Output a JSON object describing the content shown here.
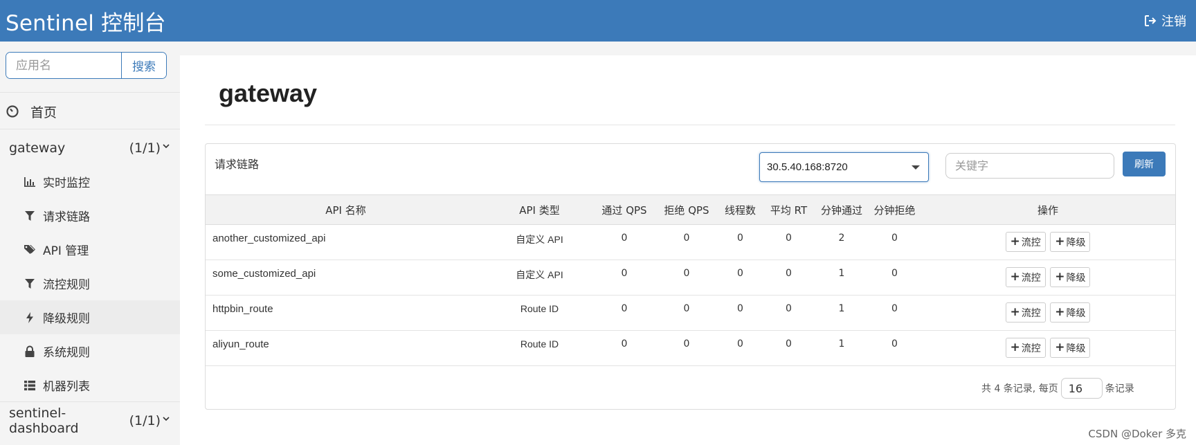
{
  "header": {
    "brand": "Sentinel 控制台",
    "logout_label": "注销"
  },
  "sidebar": {
    "search_placeholder": "应用名",
    "search_button": "搜索",
    "home_label": "首页",
    "apps": [
      {
        "name": "gateway",
        "count": "(1/1)"
      },
      {
        "name": "sentinel-dashboard",
        "count": "(1/1)"
      }
    ],
    "items": [
      {
        "label": "实时监控",
        "icon": "bar-chart-icon"
      },
      {
        "label": "请求链路",
        "icon": "filter-icon"
      },
      {
        "label": "API 管理",
        "icon": "tags-icon"
      },
      {
        "label": "流控规则",
        "icon": "filter-icon"
      },
      {
        "label": "降级规则",
        "icon": "flash-icon"
      },
      {
        "label": "系统规则",
        "icon": "lock-icon"
      },
      {
        "label": "机器列表",
        "icon": "list-icon"
      }
    ]
  },
  "main": {
    "title": "gateway",
    "panel_title": "请求链路",
    "machine": "30.5.40.168:8720",
    "keyword_placeholder": "关键字",
    "refresh_label": "刷新",
    "columns": [
      "API 名称",
      "API 类型",
      "通过 QPS",
      "拒绝 QPS",
      "线程数",
      "平均 RT",
      "分钟通过",
      "分钟拒绝",
      "操作"
    ],
    "rows": [
      {
        "name": "another_customized_api",
        "type": "自定义 API",
        "pass_qps": "0",
        "block_qps": "0",
        "threads": "0",
        "avg_rt": "0",
        "min_pass": "2",
        "min_block": "0"
      },
      {
        "name": "some_customized_api",
        "type": "自定义 API",
        "pass_qps": "0",
        "block_qps": "0",
        "threads": "0",
        "avg_rt": "0",
        "min_pass": "1",
        "min_block": "0"
      },
      {
        "name": "httpbin_route",
        "type": "Route ID",
        "pass_qps": "0",
        "block_qps": "0",
        "threads": "0",
        "avg_rt": "0",
        "min_pass": "1",
        "min_block": "0"
      },
      {
        "name": "aliyun_route",
        "type": "Route ID",
        "pass_qps": "0",
        "block_qps": "0",
        "threads": "0",
        "avg_rt": "0",
        "min_pass": "1",
        "min_block": "0"
      }
    ],
    "flow_btn": "流控",
    "degrade_btn": "降级",
    "pager": {
      "prefix": "共 4 条记录, 每页",
      "page_size": "16",
      "suffix": "条记录"
    }
  },
  "watermark": "CSDN @Doker 多克",
  "colors": {
    "brand": "#3c7ab9"
  }
}
